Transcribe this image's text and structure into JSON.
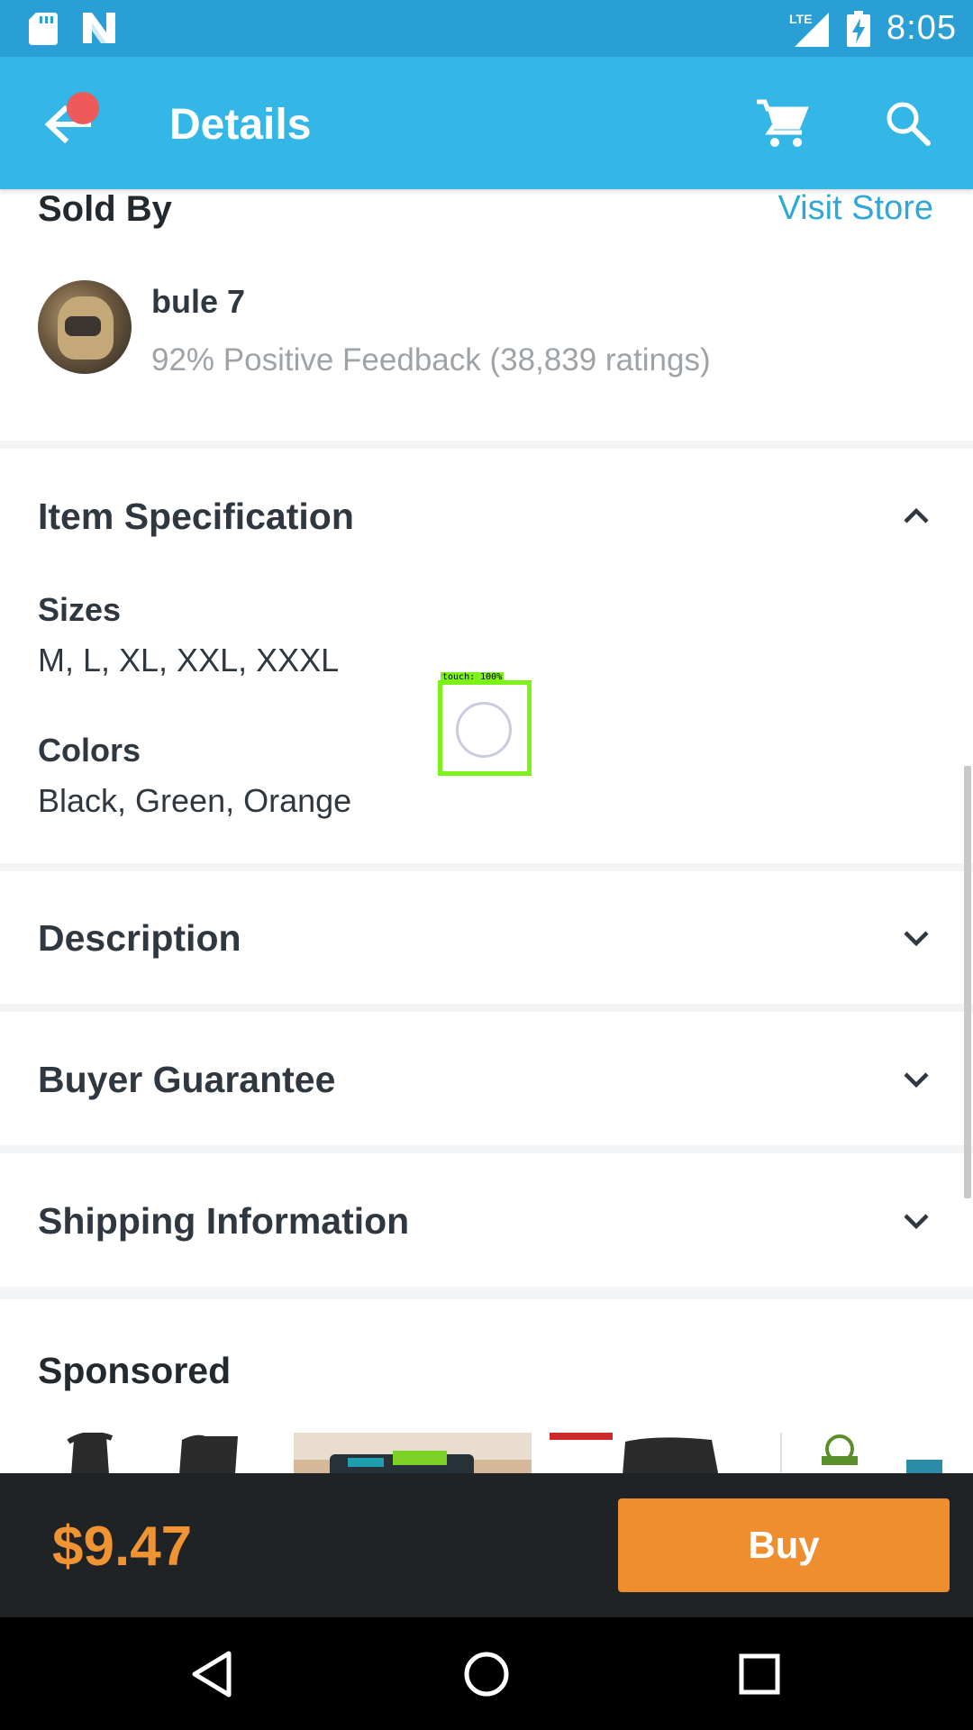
{
  "status_bar": {
    "network": "LTE",
    "time": "8:05"
  },
  "app_bar": {
    "title": "Details"
  },
  "seller": {
    "section_label": "Sold By",
    "visit_store": "Visit Store",
    "name": "bule 7",
    "feedback": "92% Positive Feedback (38,839 ratings)"
  },
  "item_spec": {
    "title": "Item Specification",
    "expanded": true,
    "sizes_label": "Sizes",
    "sizes_value": "M, L, XL, XXL, XXXL",
    "colors_label": "Colors",
    "colors_value": "Black, Green, Orange"
  },
  "sections": {
    "description": "Description",
    "buyer_guarantee": "Buyer Guarantee",
    "shipping_information": "Shipping Information"
  },
  "sponsored": {
    "title": "Sponsored"
  },
  "touch_overlay": {
    "label": "touch: 100%"
  },
  "bottom_bar": {
    "price": "$9.47",
    "buy_label": "Buy"
  },
  "colors": {
    "status_bar": "#2a9fd6",
    "app_bar": "#34b6e6",
    "accent_link": "#2fa7d9",
    "price": "#f09433",
    "buy_button": "#ef8e2f",
    "bottom_bar": "#1f2326"
  },
  "icons": [
    "sd-card-icon",
    "n-logo-icon",
    "lte-signal-icon",
    "battery-charging-icon",
    "back-arrow-icon",
    "cart-icon",
    "search-icon",
    "chevron-up-icon",
    "chevron-down-icon",
    "nav-back-icon",
    "nav-home-icon",
    "nav-recents-icon"
  ]
}
